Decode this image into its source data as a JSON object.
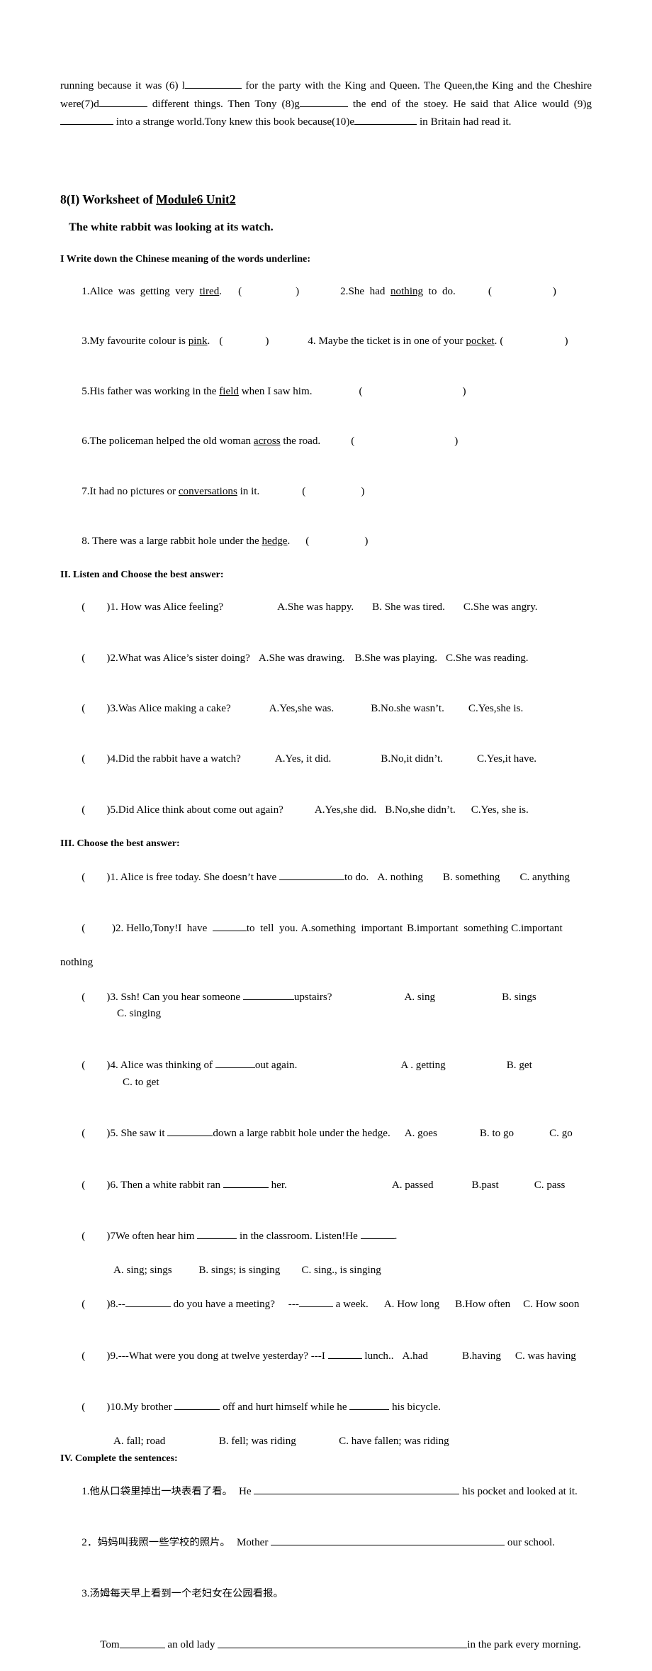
{
  "cloze_paragraph": {
    "segments": [
      {
        "t": "running because it was (6) l"
      },
      {
        "blank": 80
      },
      {
        "t": " for the party with the King and Queen. The Queen,the King and the Cheshire were(7)d"
      },
      {
        "blank": 68
      },
      {
        "t": " different things. Then Tony (8)g"
      },
      {
        "blank": 68
      },
      {
        "t": " the end of the stoey. He said that Alice would (9)g"
      },
      {
        "blank": 75
      },
      {
        "t": " into a strange world.Tony knew this book because(10)e"
      },
      {
        "blank": 88
      },
      {
        "t": " in Britain had read it."
      }
    ],
    "plain_text": "running because it was (6) l__________ for the party with the King and Queen. The Queen,the King and the Cheshire were(7)d__________ different things. Then Tony (8)g__________ the end of the stoey. He said that Alice would (9)g___________ into a strange world.Tony knew this book because(10)e____________ in Britain had read it."
  },
  "worksheet": {
    "title_prefix": "8(I) Worksheet of ",
    "title_underlined": "Module6 Unit2",
    "subtitle": "The white rabbit was looking at its watch."
  },
  "section1": {
    "heading": "I Write down the Chinese meaning of the words underline:",
    "rows": [
      {
        "left": {
          "num": "1.",
          "pre": "Alice  was  getting  very  ",
          "word": "tired",
          "post": ".",
          "paren_open": "(",
          "paren_close": ")"
        },
        "right": {
          "num": "2.",
          "pre": "She  had  ",
          "word": "nothing",
          "post": "  to  do.",
          "paren_open": "(",
          "paren_close": ")"
        }
      },
      {
        "left": {
          "num": "3.",
          "pre": "My favourite colour is ",
          "word": "pink",
          "post": ".",
          "paren_open": "(",
          "paren_close": ")"
        },
        "right": {
          "num": "4. ",
          "pre": "Maybe the ticket is in one of your ",
          "word": "pocket",
          "post": ".",
          "paren_open": "(",
          "paren_close": ")"
        }
      },
      {
        "left": {
          "num": "5.",
          "pre": "His father was working in the ",
          "word": "field",
          "post": " when I saw him.",
          "paren_open": "(",
          "paren_close": ")"
        },
        "right": null
      },
      {
        "left": {
          "num": "6.",
          "pre": "The policeman helped the old woman ",
          "word": "across",
          "post": " the road.",
          "paren_open": "(",
          "paren_close": ")"
        },
        "right": null
      },
      {
        "left": {
          "num": "7.",
          "pre": "It had no pictures or ",
          "word": "conversations",
          "post": " in it.",
          "paren_open": "(",
          "paren_close": ")"
        },
        "right": null
      },
      {
        "left": {
          "num": "8. ",
          "pre": "There was a large rabbit hole under the ",
          "word": "hedge",
          "post": ".",
          "paren_open": "(",
          "paren_close": ")"
        },
        "right": null
      }
    ]
  },
  "section2": {
    "heading": "II.  Listen and Choose the best answer:",
    "items": [
      {
        "mark": "(        )",
        "num": "1. ",
        "question": "How was Alice feeling?",
        "a": "A.She was happy.",
        "b": "B. She was tired.",
        "c": "C.She was angry."
      },
      {
        "mark": "(        )",
        "num": "2.",
        "question": "What was Alice’s sister doing?",
        "a": "A.She was drawing.",
        "b": "B.She was playing.",
        "c": "C.She was reading."
      },
      {
        "mark": "(        )",
        "num": "3.",
        "question": "Was Alice making a cake?",
        "a": "A.Yes,she was.",
        "b": "B.No.she wasn’t.",
        "c": "C.Yes,she is."
      },
      {
        "mark": "(        )",
        "num": "4.",
        "question": "Did the rabbit have a watch?",
        "a": "A.Yes, it did.",
        "b": "B.No,it didn’t.",
        "c": "C.Yes,it have."
      },
      {
        "mark": "(        )",
        "num": "5.",
        "question": "Did Alice think about come out again?",
        "a": "A.Yes,she did.",
        "b": "B.No,she didn’t.",
        "c": "C.Yes, she is."
      }
    ]
  },
  "section3": {
    "heading": "III. Choose the best answer:",
    "items": [
      {
        "mark": "(        )",
        "num": "1. ",
        "stem_pre": "Alice is free today. She doesn’t have ",
        "blank": 92,
        "stem_post": "to do.",
        "a": "A. nothing",
        "b": "B. something",
        "c": "C. anything",
        "wrap": null
      },
      {
        "mark": "(          )",
        "num": "2. ",
        "stem_pre": "Hello,Tony!I  have  ",
        "blank": 48,
        "stem_post": "to  tell  you.",
        "a": "A.something  important",
        "b": "B.important  something",
        "c": "C.important",
        "wrap": "nothing"
      },
      {
        "mark": "(        )",
        "num": "3. ",
        "stem_pre": "Ssh! Can you hear someone ",
        "blank": 72,
        "stem_post": "upstairs?",
        "a": "A. sing",
        "b": "B. sings",
        "c": "C. singing",
        "wrap": null
      },
      {
        "mark": "(        )",
        "num": "4. ",
        "stem_pre": "Alice was thinking of ",
        "blank": 56,
        "stem_post": "out again.",
        "a": "A . getting",
        "b": "B. get",
        "c": "C. to get",
        "wrap": null
      },
      {
        "mark": "(        )",
        "num": "5. ",
        "stem_pre": "She saw it ",
        "blank": 64,
        "stem_post": "down a large rabbit hole under the hedge.",
        "a": "A. goes",
        "b": "B. to go",
        "c": "C. go",
        "wrap": null
      },
      {
        "mark": "(        )",
        "num": "6. ",
        "stem_pre": "Then a white rabbit ran ",
        "blank": 64,
        "stem_post": " her.",
        "a": "A. passed",
        "b": "B.past",
        "c": "C. pass",
        "wrap": null
      }
    ],
    "item7": {
      "mark": "(        )",
      "num": "7",
      "stem_pre": "We often hear him ",
      "blank1": 56,
      "stem_mid": " in the classroom. Listen!He ",
      "blank2": 48,
      "stem_post": ".",
      "answers": "A. sing; sings          B. sings; is singing        C. sing., is singing"
    },
    "item8": {
      "mark": "(        )",
      "num": "8.--",
      "blank1": 64,
      "stem_mid": " do you have a meeting?     ---",
      "blank2": 48,
      "stem_post": " a week.",
      "a": "A. How long",
      "b": "B.How often",
      "c": "C. How soon"
    },
    "item9": {
      "mark": "(        )",
      "num": "9.---",
      "stem_pre": "What were you dong at twelve yesterday? ---I ",
      "blank": 48,
      "stem_post": " lunch..",
      "a": "A.had",
      "b": "B.having",
      "c": "C. was having"
    },
    "item10": {
      "mark": "(        )",
      "num": "10.",
      "stem_pre": "My brother ",
      "blank1": 64,
      "stem_mid": " off and hurt himself while he ",
      "blank2": 56,
      "stem_post": " his bicycle.",
      "answers": "A. fall; road                    B. fell; was riding                C. have fallen; was riding"
    }
  },
  "section4": {
    "heading": "IV. Complete the sentences:",
    "items": [
      {
        "num": "1.",
        "chinese": "他从口袋里掉出一块表看了看。",
        "en_pre": "He ",
        "blank": 290,
        "en_post": " his pocket and looked at it."
      },
      {
        "num": "2．",
        "chinese": "妈妈叫我照一些学校的照片。",
        "en_pre": "Mother ",
        "blank": 330,
        "en_post": " our school."
      },
      {
        "num": "3.",
        "chinese": "汤姆每天早上看到一个老妇女在公园看报。",
        "en_pre2": "Tom",
        "blank_a": 64,
        "en_mid": " an old lady ",
        "blank_b": 352,
        "en_post": "in the park every morning."
      }
    ]
  }
}
